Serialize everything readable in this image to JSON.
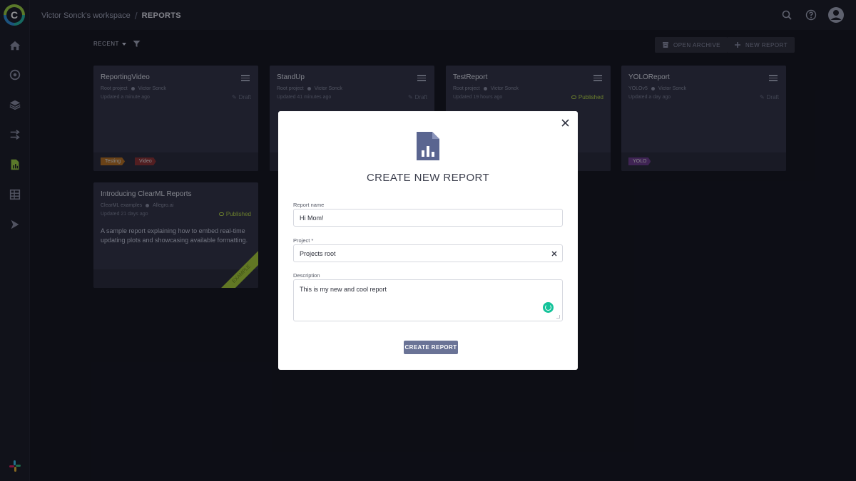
{
  "header": {
    "workspace": "Victor Sonck's workspace",
    "separator": "/",
    "section": "REPORTS"
  },
  "toolbar": {
    "sort_label": "RECENT",
    "open_archive_label": "OPEN ARCHIVE",
    "new_report_label": "NEW REPORT"
  },
  "cards": [
    {
      "title": "ReportingVideo",
      "project": "Root project",
      "author": "Victor Sonck",
      "updated": "Updated a minute ago",
      "status": "Draft",
      "tags": [
        {
          "label": "Testing",
          "color": "#b8701c"
        },
        {
          "label": "Video",
          "color": "#8a2e2e"
        }
      ]
    },
    {
      "title": "StandUp",
      "project": "Root project",
      "author": "Victor Sonck",
      "updated": "Updated 41 minutes ago",
      "status": "Draft"
    },
    {
      "title": "TestReport",
      "project": "Root project",
      "author": "Victor Sonck",
      "updated": "Updated 19 hours ago",
      "status": "Published"
    },
    {
      "title": "YOLOReport",
      "project": "YOLOv5",
      "author": "Victor Sonck",
      "updated": "Updated a day ago",
      "status": "Draft",
      "tags": [
        {
          "label": "YOLO",
          "color": "#6a3a8a"
        }
      ]
    },
    {
      "title": "Introducing ClearML Reports",
      "project": "ClearML examples",
      "author": "Allegro.ai",
      "updated": "Updated 21 days ago",
      "status": "Published",
      "description": "A sample report explaining how to embed real-time updating plots and showcasing available formatting.",
      "ribbon": "EXAMPLE"
    }
  ],
  "modal": {
    "title": "CREATE NEW REPORT",
    "report_name_label": "Report name",
    "report_name_value": "Hi Mom!",
    "project_label": "Project *",
    "project_value": "Projects root",
    "description_label": "Description",
    "description_value": "This is my new and cool report",
    "submit_label": "CREATE REPORT"
  },
  "colors": {
    "accent": "#6a7396",
    "published": "#b7d944",
    "background": "#101119"
  }
}
